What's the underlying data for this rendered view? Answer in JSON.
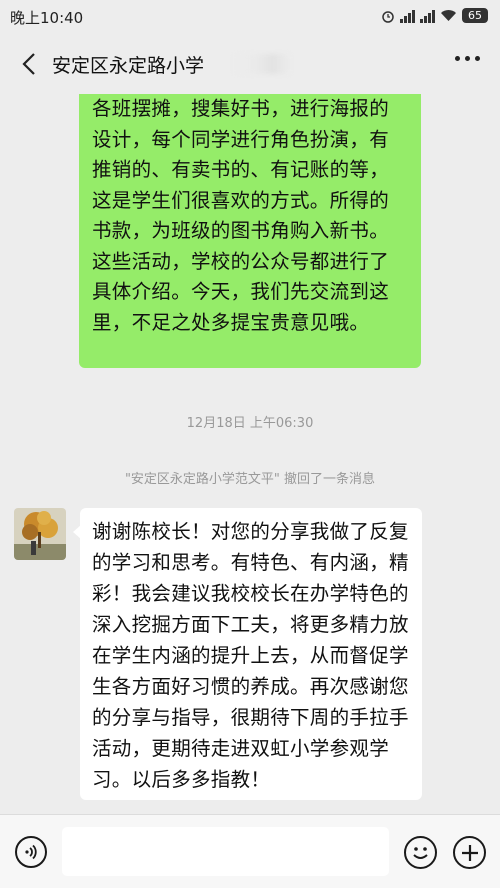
{
  "status_bar": {
    "time": "晚上10:40",
    "battery": "65",
    "icons": [
      "alarm-icon",
      "signal-icon",
      "signal-icon",
      "wifi-icon",
      "battery-icon"
    ]
  },
  "header": {
    "title": "安定区永定路小学",
    "back_icon": "chevron-left-icon",
    "more_icon": "more-dots-icon"
  },
  "messages": [
    {
      "sender": "self",
      "text": "各班摆摊，搜集好书，进行海报的设计，每个同学进行角色扮演，有推销的、有卖书的、有记账的等，这是学生们很喜欢的方式。所得的书款，为班级的图书角购入新书。这些活动，学校的公众号都进行了具体介绍。今天，我们先交流到这里，不足之处多提宝贵意见哦。"
    },
    {
      "sender": "other",
      "text": "谢谢陈校长！对您的分享我做了反复的学习和思考。有特色、有内涵，精彩！我会建议我校校长在办学特色的深入挖掘方面下工夫，将更多精力放在学生内涵的提升上去，从而督促学生各方面好习惯的养成。再次感谢您的分享与指导，很期待下周的手拉手活动，更期待走进双虹小学参观学习。以后多多指教！"
    }
  ],
  "timestamp": "12月18日 上午06:30",
  "recall_notice": "\"安定区永定路小学范文平\" 撤回了一条消息",
  "input_bar": {
    "placeholder": "",
    "voice_icon": "voice-icon",
    "emoji_icon": "emoji-icon",
    "plus_icon": "plus-icon"
  },
  "colors": {
    "background": "#ededed",
    "self_bubble": "#95ec69",
    "other_bubble": "#ffffff",
    "meta_text": "#999999"
  }
}
